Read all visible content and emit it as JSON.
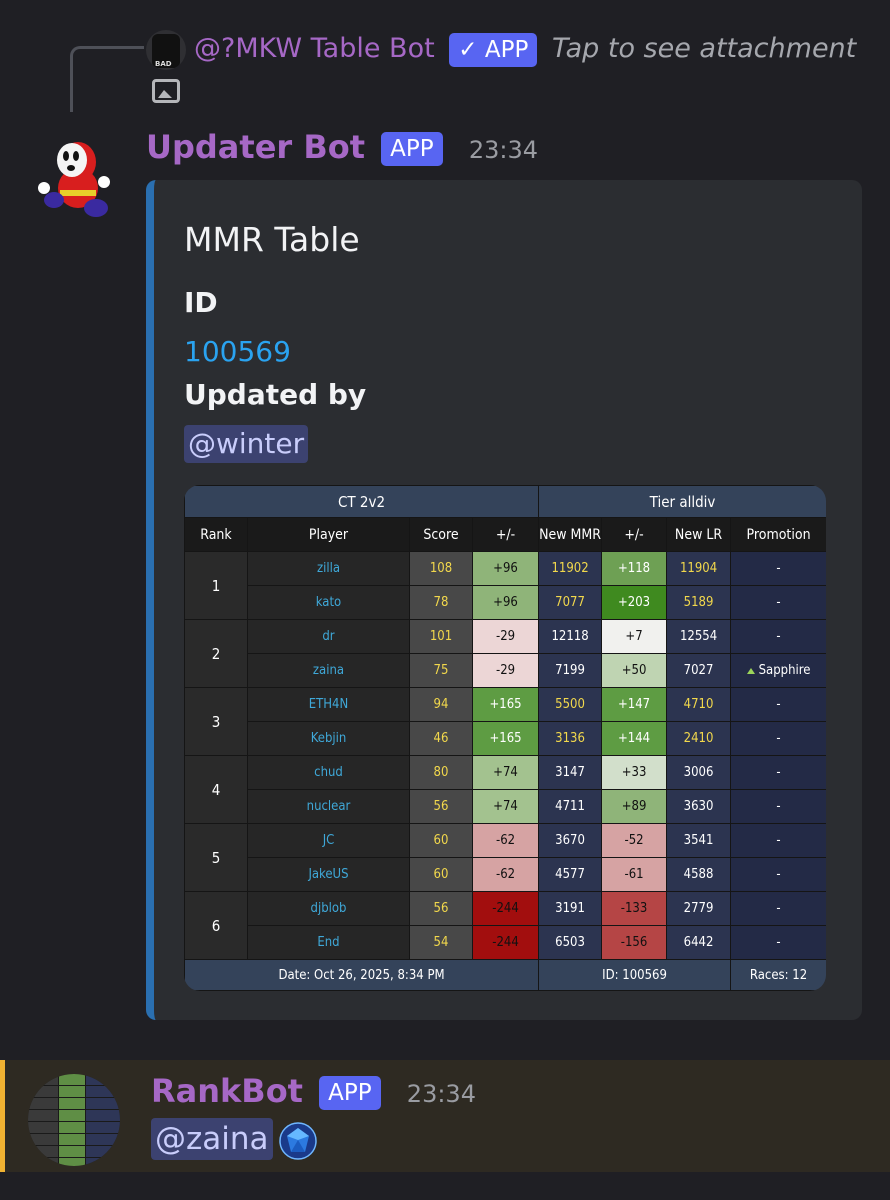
{
  "reply": {
    "author": "@?MKW Table Bot",
    "badge": "✓ APP",
    "snippet": "Tap to see attachment"
  },
  "message": {
    "author": "Updater Bot",
    "badge": "APP",
    "time": "23:34"
  },
  "embed": {
    "title": "MMR Table",
    "id_label": "ID",
    "id_value": "100569",
    "updated_label": "Updated by",
    "updated_mention": "@winter"
  },
  "table": {
    "left_header": "CT 2v2",
    "right_header": "Tier alldiv",
    "columns": [
      "Rank",
      "Player",
      "Score",
      "+/-",
      "New MMR",
      "+/-",
      "New LR",
      "Promotion"
    ],
    "rows": [
      {
        "rank": "1",
        "player": "zilla",
        "score": "108",
        "mmr_delta": "+96",
        "new_mmr": "11902",
        "lr_delta": "+118",
        "new_lr": "11904",
        "promotion": "-"
      },
      {
        "rank": "1",
        "player": "kato",
        "score": "78",
        "mmr_delta": "+96",
        "new_mmr": "7077",
        "lr_delta": "+203",
        "new_lr": "5189",
        "promotion": "-"
      },
      {
        "rank": "2",
        "player": "dr",
        "score": "101",
        "mmr_delta": "-29",
        "new_mmr": "12118",
        "lr_delta": "+7",
        "new_lr": "12554",
        "promotion": "-"
      },
      {
        "rank": "2",
        "player": "zaina",
        "score": "75",
        "mmr_delta": "-29",
        "new_mmr": "7199",
        "lr_delta": "+50",
        "new_lr": "7027",
        "promotion": "Sapphire"
      },
      {
        "rank": "3",
        "player": "ETH4N",
        "score": "94",
        "mmr_delta": "+165",
        "new_mmr": "5500",
        "lr_delta": "+147",
        "new_lr": "4710",
        "promotion": "-"
      },
      {
        "rank": "3",
        "player": "Kebjin",
        "score": "46",
        "mmr_delta": "+165",
        "new_mmr": "3136",
        "lr_delta": "+144",
        "new_lr": "2410",
        "promotion": "-"
      },
      {
        "rank": "4",
        "player": "chud",
        "score": "80",
        "mmr_delta": "+74",
        "new_mmr": "3147",
        "lr_delta": "+33",
        "new_lr": "3006",
        "promotion": "-"
      },
      {
        "rank": "4",
        "player": "nuclear",
        "score": "56",
        "mmr_delta": "+74",
        "new_mmr": "4711",
        "lr_delta": "+89",
        "new_lr": "3630",
        "promotion": "-"
      },
      {
        "rank": "5",
        "player": "JC",
        "score": "60",
        "mmr_delta": "-62",
        "new_mmr": "3670",
        "lr_delta": "-52",
        "new_lr": "3541",
        "promotion": "-"
      },
      {
        "rank": "5",
        "player": "JakeUS",
        "score": "60",
        "mmr_delta": "-62",
        "new_mmr": "4577",
        "lr_delta": "-61",
        "new_lr": "4588",
        "promotion": "-"
      },
      {
        "rank": "6",
        "player": "djblob",
        "score": "56",
        "mmr_delta": "-244",
        "new_mmr": "3191",
        "lr_delta": "-133",
        "new_lr": "2779",
        "promotion": "-"
      },
      {
        "rank": "6",
        "player": "End",
        "score": "54",
        "mmr_delta": "-244",
        "new_mmr": "6503",
        "lr_delta": "-156",
        "new_lr": "6442",
        "promotion": "-"
      }
    ],
    "footer_date": "Date: Oct 26, 2025, 8:34 PM",
    "footer_id": "ID: 100569",
    "footer_races": "Races: 12"
  },
  "rankbot": {
    "author": "RankBot",
    "badge": "APP",
    "time": "23:34",
    "mention": "@zaina"
  },
  "colors": {
    "accent_purple": "#a668c6",
    "app_badge": "#5865f2",
    "embed_border": "#2a6fb0",
    "link": "#2aa3f0",
    "highlight_bar": "#f0b232"
  },
  "icons": {
    "reply_image": "image-icon",
    "gem": "sapphire-gem-icon"
  }
}
